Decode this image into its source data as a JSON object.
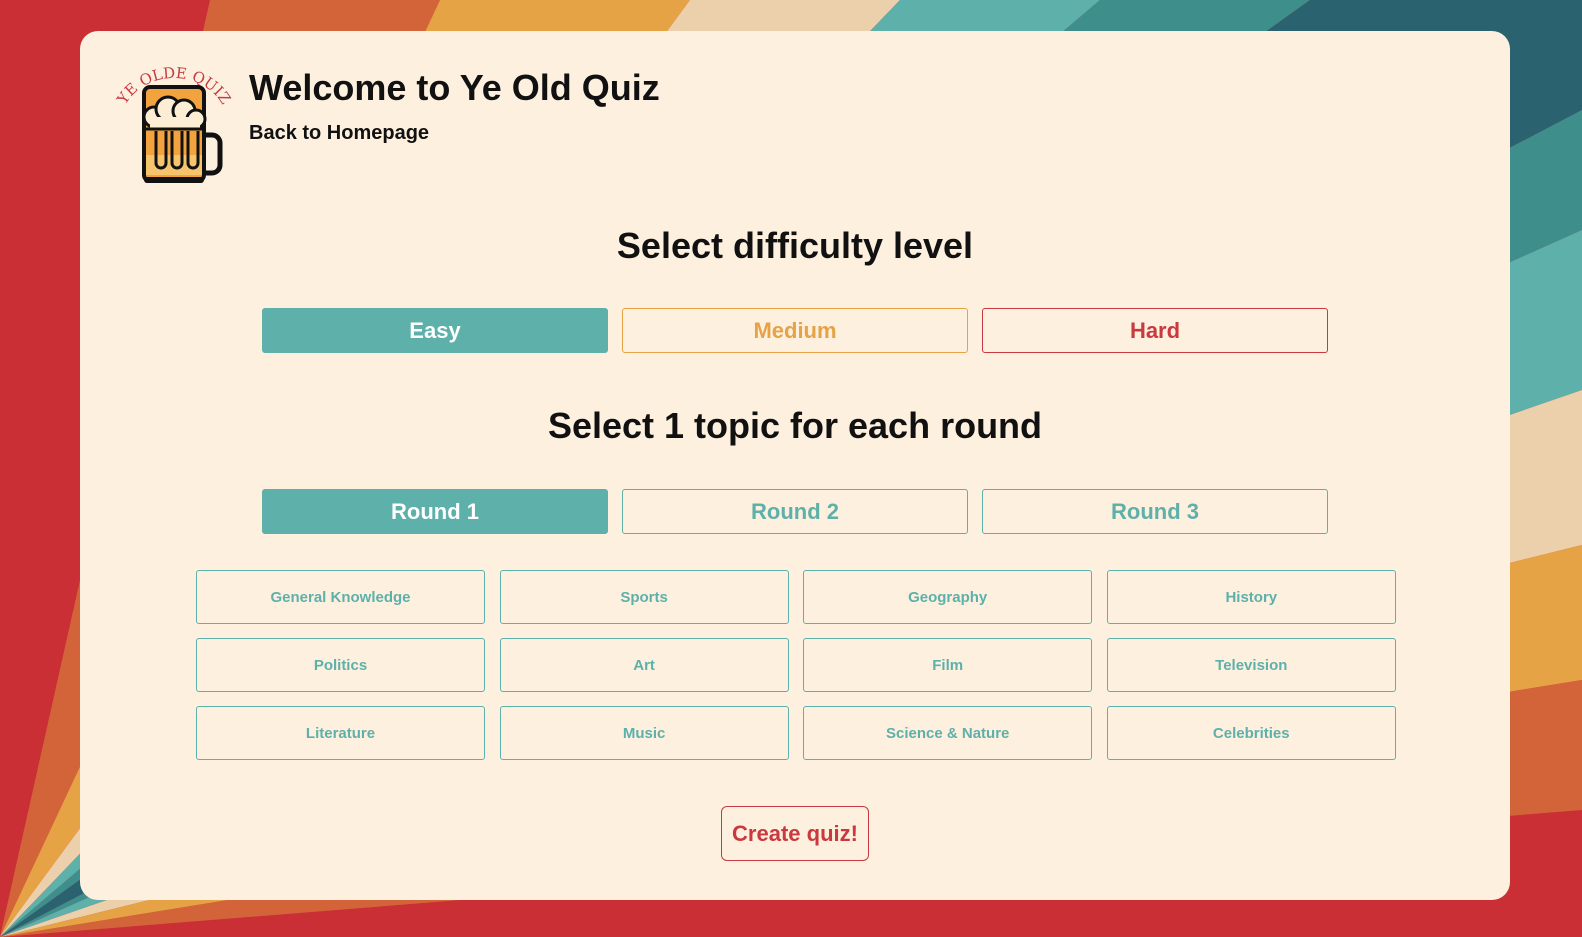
{
  "colors": {
    "card_background": "#fdf0df",
    "teal": "#5eb0aa",
    "orange": "#e5a346",
    "red": "#c9393f",
    "background_stripes": [
      "#c92f35",
      "#d3643a",
      "#e5a346",
      "#ecd0ab",
      "#5eb0aa",
      "#3e8f8c",
      "#2a6270"
    ]
  },
  "header": {
    "logo_text": "YE OLDE QUIZ",
    "logo_icon": "beer-mug-icon",
    "title": "Welcome to Ye Old Quiz",
    "back_link": "Back to Homepage"
  },
  "difficulty": {
    "heading": "Select difficulty level",
    "options": [
      "Easy",
      "Medium",
      "Hard"
    ],
    "selected": "Easy"
  },
  "rounds": {
    "heading": "Select 1 topic for each round",
    "tabs": [
      "Round 1",
      "Round 2",
      "Round 3"
    ],
    "selected": "Round 1"
  },
  "topics": [
    "General Knowledge",
    "Sports",
    "Geography",
    "History",
    "Politics",
    "Art",
    "Film",
    "Television",
    "Literature",
    "Music",
    "Science & Nature",
    "Celebrities"
  ],
  "create_button": "Create quiz!"
}
